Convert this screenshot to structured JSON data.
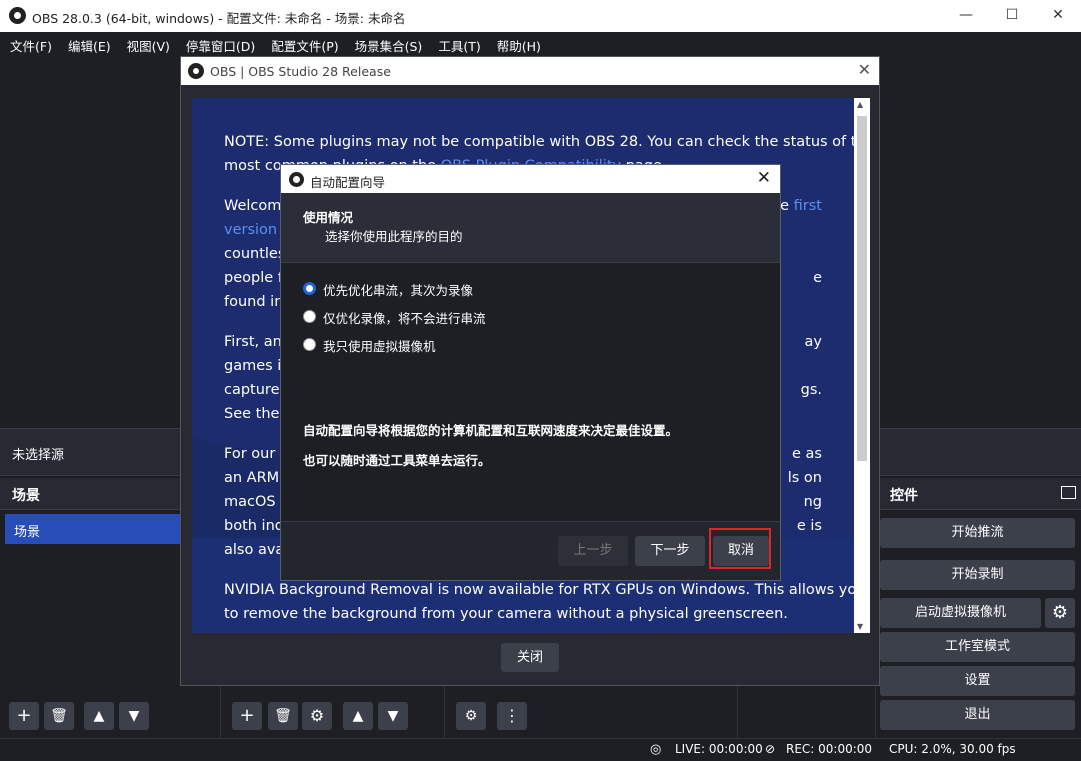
{
  "window": {
    "title": "OBS 28.0.3 (64-bit, windows) - 配置文件: 未命名 - 场景: 未命名",
    "minimize": "—",
    "maximize": "☐",
    "close": "✕"
  },
  "menu": [
    "文件(F)",
    "编辑(E)",
    "视图(V)",
    "停靠窗口(D)",
    "配置文件(P)",
    "场景集合(S)",
    "工具(T)",
    "帮助(H)"
  ],
  "sources_bar": {
    "no_source": "未选择源"
  },
  "scenes": {
    "header": "场景",
    "items": [
      "场景"
    ]
  },
  "controls": {
    "header": "控件",
    "start_stream": "开始推流",
    "start_record": "开始录制",
    "virtual_cam": "启动虚拟摄像机",
    "studio_mode": "工作室模式",
    "settings": "设置",
    "exit": "退出"
  },
  "status": {
    "live": "LIVE: 00:00:00",
    "rec": "REC: 00:00:00",
    "cpu": "CPU: 2.0%, 30.00 fps"
  },
  "release_notes": {
    "title": "OBS | OBS Studio 28 Release",
    "close_label": "关闭",
    "lines": [
      {
        "pre": "NOTE: Some plugins may not be compatible with OBS 28. You can check the status of the",
        "link": "",
        "post": ""
      },
      {
        "pre": "most common plugins on the ",
        "link": "OBS Plugin Compatibility",
        "post": " page."
      },
      {
        "pre": "Welcome",
        "link": "",
        "post": ""
      },
      {
        "pre": "",
        "link": "version o",
        "post": ""
      },
      {
        "pre": "countless",
        "link": "",
        "post": ""
      },
      {
        "pre": "people fi",
        "link": "",
        "post": ""
      },
      {
        "pre": "found in",
        "link": "",
        "post": ""
      },
      {
        "pre": "First, and",
        "link": "",
        "post": ""
      },
      {
        "pre": "games in",
        "link": "",
        "post": ""
      },
      {
        "pre": "capture a",
        "link": "",
        "post": ""
      },
      {
        "pre": "See the",
        "link": "",
        "post": ""
      },
      {
        "pre": "For our A",
        "link": "",
        "post": ""
      },
      {
        "pre": "an ARM6",
        "link": "",
        "post": ""
      },
      {
        "pre": "macOS",
        "link": "",
        "post": ""
      },
      {
        "pre": "both indi",
        "link": "",
        "post": ""
      },
      {
        "pre": "also avai",
        "link": "",
        "post": ""
      },
      {
        "pre": "NVIDIA Background Removal is now available for RTX GPUs on Windows. This allows you",
        "link": "",
        "post": ""
      },
      {
        "pre": "to remove the background from your camera without a physical greenscreen.",
        "link": "",
        "post": ""
      }
    ],
    "right_fragments": [
      {
        "text": "he ",
        "link": "first"
      },
      {
        "text": "e",
        "link": ""
      },
      {
        "text": "ay",
        "link": ""
      },
      {
        "text": "gs.",
        "link": ""
      },
      {
        "text": "e as",
        "link": ""
      },
      {
        "text": "ls on",
        "link": ""
      },
      {
        "text": "ng",
        "link": ""
      },
      {
        "text": "e is",
        "link": ""
      }
    ]
  },
  "wizard": {
    "title": "自动配置向导",
    "heading": "使用情况",
    "subheading": "选择你使用此程序的目的",
    "options": [
      {
        "label": "优先优化串流，其次为录像",
        "selected": true
      },
      {
        "label": "仅优化录像，将不会进行串流",
        "selected": false
      },
      {
        "label": "我只使用虚拟摄像机",
        "selected": false
      }
    ],
    "desc1": "自动配置向导将根据您的计算机配置和互联网速度来决定最佳设置。",
    "desc2": "也可以随时通过工具菜单去运行。",
    "prev": "上一步",
    "next": "下一步",
    "cancel": "取消",
    "close": "✕"
  },
  "colors": {
    "accent": "#1d67d4",
    "scene_selected": "#284cb8",
    "highlight": "#e0242a",
    "notes_bg": "#1c2c6e",
    "link": "#5d8ff3"
  }
}
